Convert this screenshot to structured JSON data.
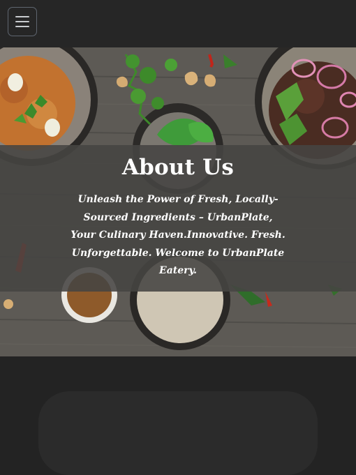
{
  "navbar": {
    "menu_icon": "hamburger-menu-icon"
  },
  "hero": {
    "image_description_icon": "food-table-photo",
    "title": "About Us",
    "tagline": "Unleash the Power of Fresh, Locally-Sourced Ingredients – UrbanPlate, Your Culinary Haven.Innovative. Fresh. Unforgettable. Welcome to UrbanPlate Eatery."
  },
  "colors": {
    "page_background": "#232323",
    "navbar_background": "#262626",
    "overlay_background": "#464442",
    "text": "#ffffff"
  }
}
